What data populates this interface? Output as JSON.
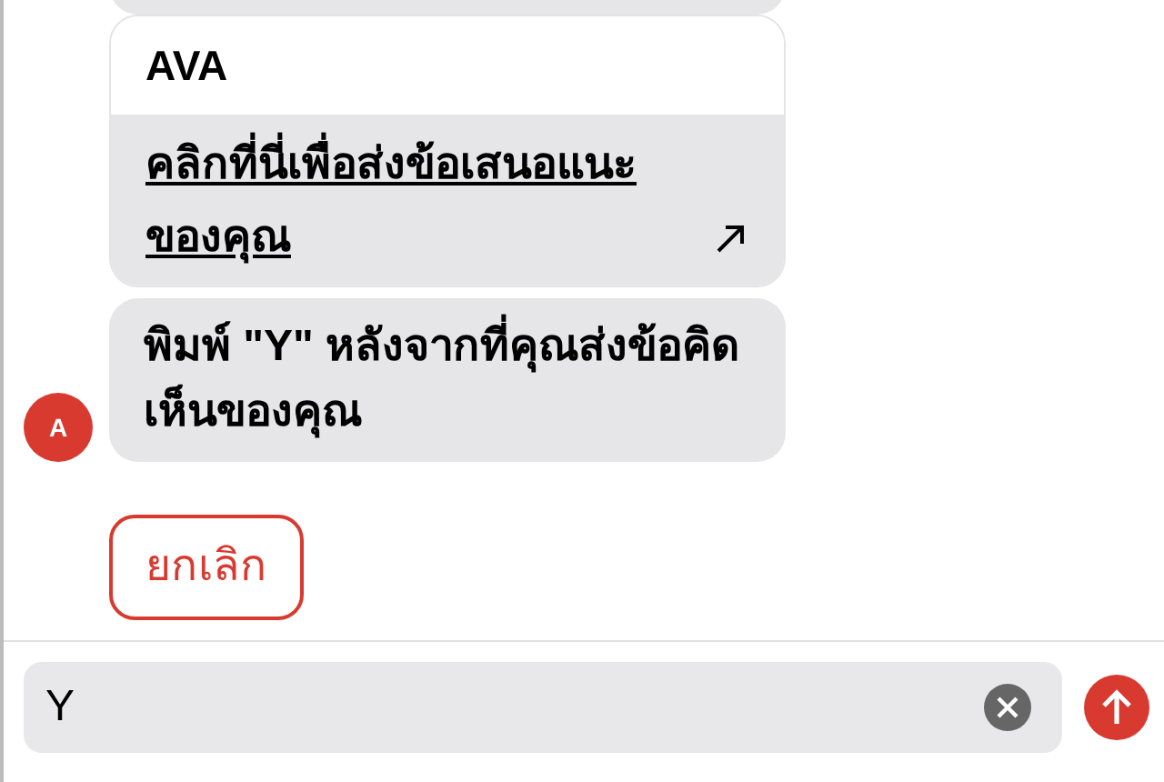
{
  "card": {
    "title": "AVA",
    "link": "คลิกที่นี่เพื่อส่งข้อเสนอแนะของคุณ"
  },
  "message": {
    "avatar": "A",
    "text": "พิมพ์ \"Y\" หลังจากที่คุณส่งข้อคิดเห็นของคุณ"
  },
  "cancel_button": "ยกเลิก",
  "composer": {
    "value": "Y"
  }
}
